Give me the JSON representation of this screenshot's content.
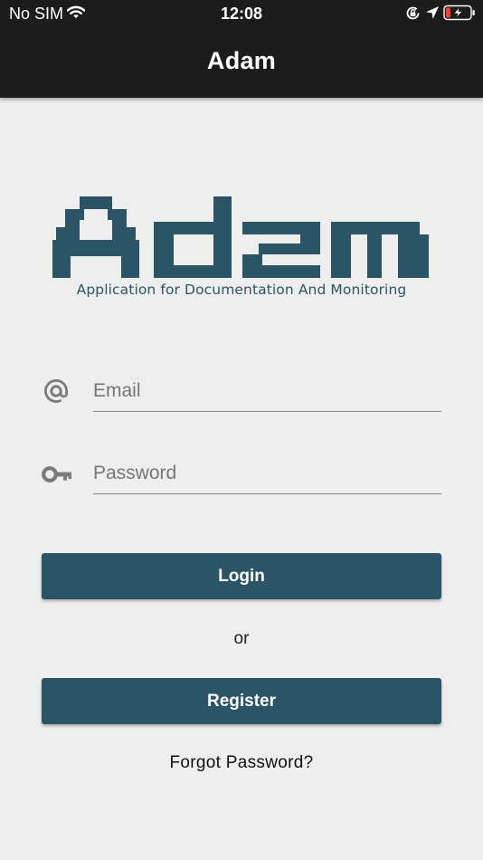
{
  "status_bar": {
    "carrier": "No SIM",
    "time": "12:08"
  },
  "header": {
    "title": "Adam"
  },
  "logo": {
    "subtitle": "Application for Documentation And Monitoring",
    "color": "#2b5466"
  },
  "form": {
    "email_placeholder": "Email",
    "password_placeholder": "Password",
    "login_label": "Login",
    "or_label": "or",
    "register_label": "Register",
    "forgot_label": "Forgot Password?"
  },
  "colors": {
    "header_bg": "#1c1c1c",
    "page_bg": "#eeeeee",
    "accent": "#2b5466"
  },
  "icons": {
    "email": "at-sign-icon",
    "password": "key-icon"
  }
}
